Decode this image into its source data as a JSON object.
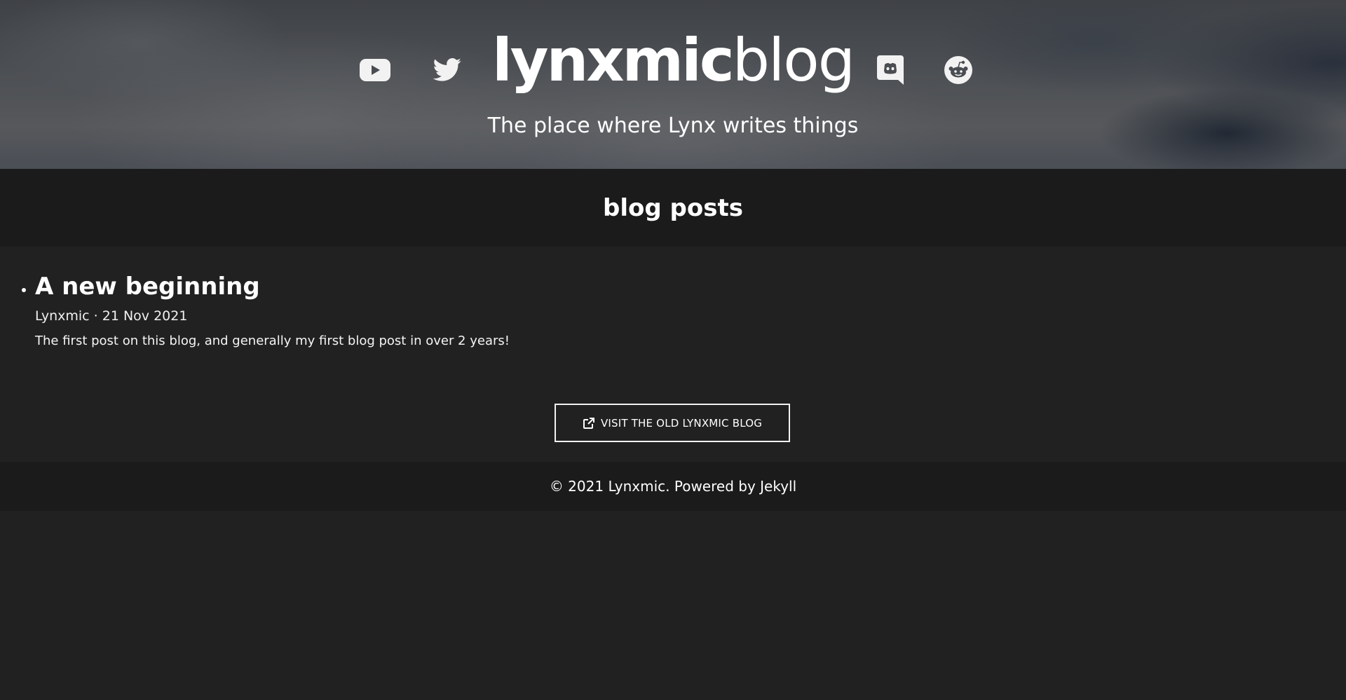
{
  "header": {
    "brand_bold": "lynxmic",
    "brand_light": "blog",
    "tagline": "The place where Lynx writes things",
    "social_icons": [
      "youtube-icon",
      "twitter-icon",
      "discord-icon",
      "reddit-icon"
    ]
  },
  "posts_section": {
    "heading": "blog posts",
    "posts": [
      {
        "title": "A new beginning",
        "author": "Lynxmic",
        "separator": "·",
        "date": "21 Nov 2021",
        "excerpt": "The first post on this blog, and generally my first blog post in over 2 years!"
      }
    ],
    "old_blog_button": {
      "label": "VISIT THE OLD LYNXMIC BLOG",
      "icon": "external-link-icon"
    }
  },
  "footer": {
    "copyright": "© 2021 Lynxmic.",
    "powered_by": "Powered by Jekyll"
  },
  "colors": {
    "background": "#212121",
    "section_band": "#1b1b1b",
    "text": "#ffffff"
  }
}
